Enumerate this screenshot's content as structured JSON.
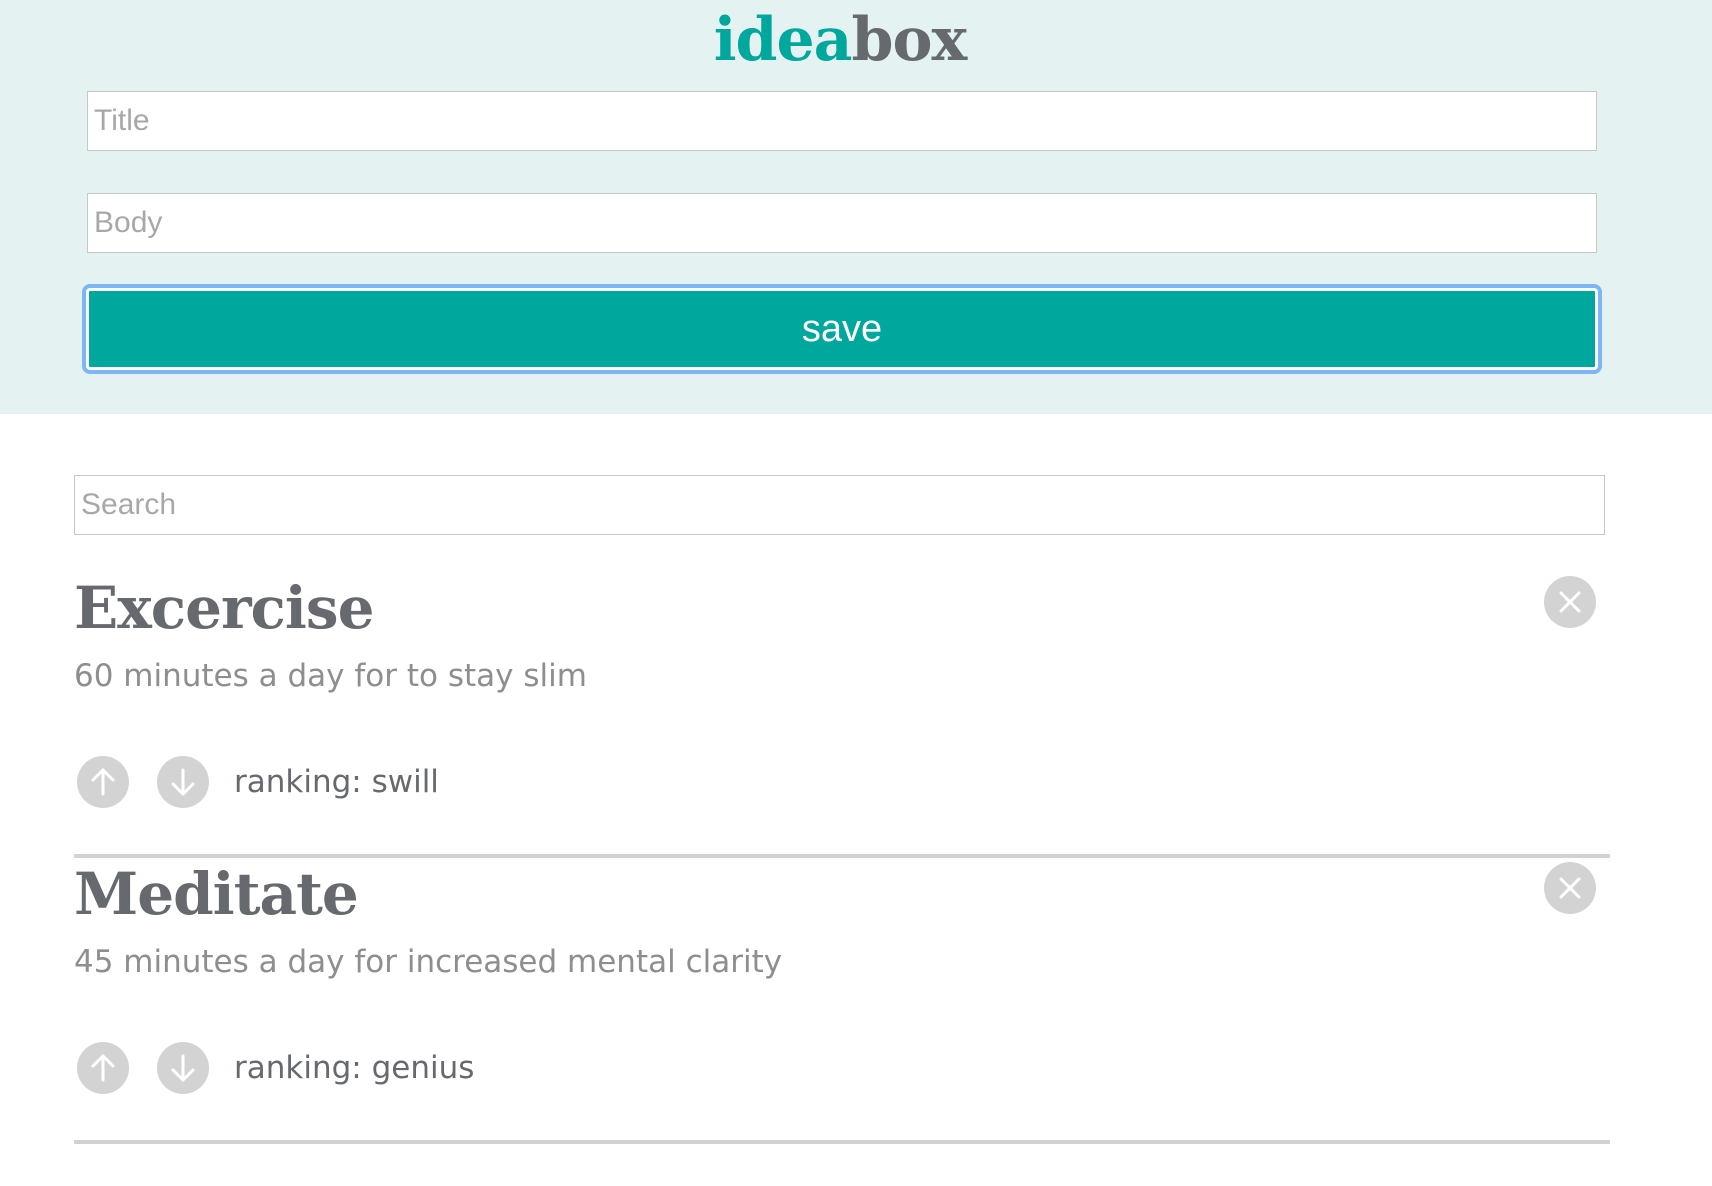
{
  "header": {
    "logo_part1": "idea",
    "logo_part2": "box",
    "title_placeholder": "Title",
    "body_placeholder": "Body",
    "save_label": "save",
    "colors": {
      "accent": "#00a79d",
      "header_bg": "#e4f2f2",
      "text_dark": "#666a6f"
    }
  },
  "search": {
    "placeholder": "Search"
  },
  "ideas": [
    {
      "title": "Excercise",
      "body": "60 minutes a day for to stay slim",
      "ranking": "ranking: swill"
    },
    {
      "title": "Meditate",
      "body": "45 minutes a day for increased mental clarity",
      "ranking": "ranking: genius"
    }
  ],
  "icons": {
    "delete": "close-icon",
    "upvote": "arrow-up-icon",
    "downvote": "arrow-down-icon"
  }
}
